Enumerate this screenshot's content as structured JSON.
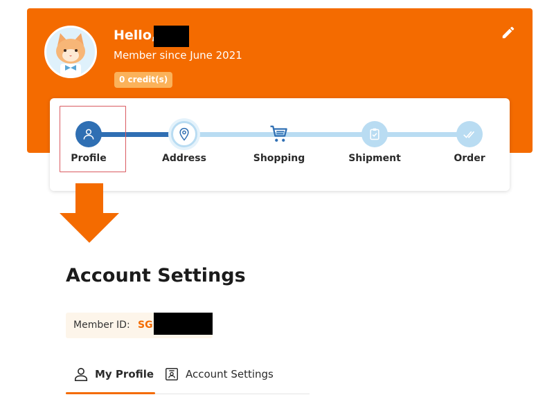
{
  "header": {
    "greeting": "Hello,",
    "member_since": "Member since June 2021",
    "credits": "0 credit(s)"
  },
  "colors": {
    "brand_orange": "#f46b00",
    "step_active": "#2f6fb3",
    "step_inactive": "#b9dcf2",
    "highlight_box": "#d9595f"
  },
  "steps": [
    {
      "label": "Profile",
      "icon": "user-icon",
      "state": "active"
    },
    {
      "label": "Address",
      "icon": "location-pin-icon",
      "state": "current"
    },
    {
      "label": "Shopping",
      "icon": "shopping-cart-icon",
      "state": "pending"
    },
    {
      "label": "Shipment",
      "icon": "clipboard-check-icon",
      "state": "pending"
    },
    {
      "label": "Order",
      "icon": "double-check-icon",
      "state": "pending"
    }
  ],
  "page": {
    "title": "Account Settings",
    "member_id_label": "Member ID:",
    "member_id_prefix": "SG"
  },
  "tabs": [
    {
      "label": "My Profile",
      "icon": "user-outline-icon",
      "active": true
    },
    {
      "label": "Account Settings",
      "icon": "id-card-icon",
      "active": false
    }
  ]
}
